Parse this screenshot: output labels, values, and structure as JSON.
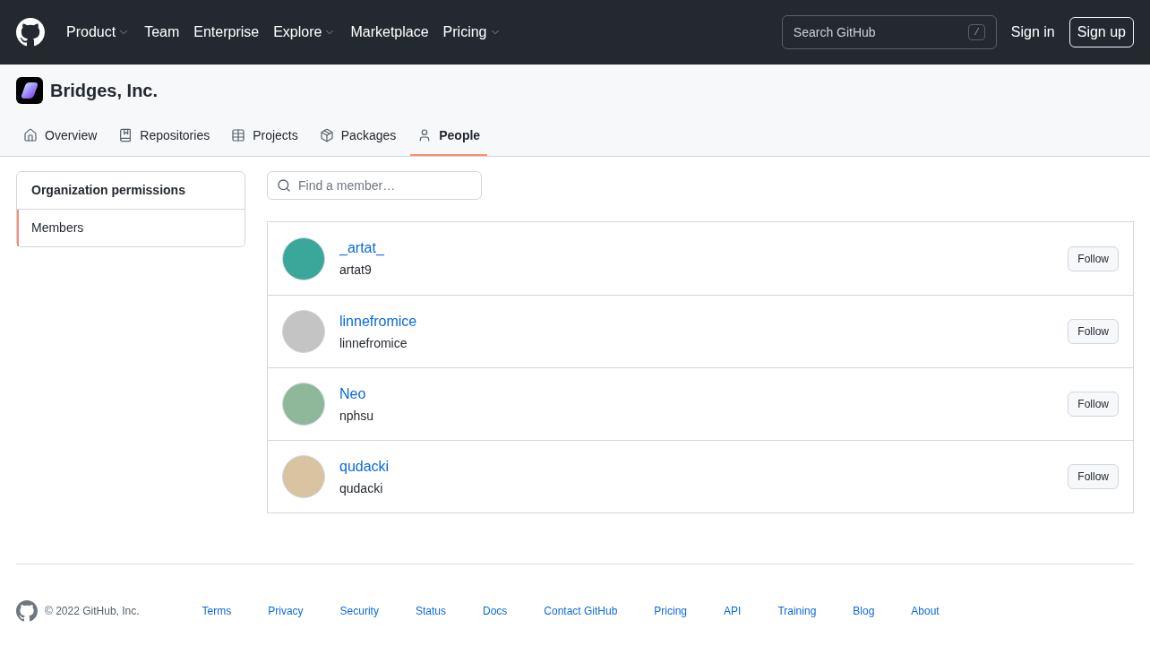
{
  "header": {
    "nav": [
      {
        "label": "Product",
        "has_menu": true
      },
      {
        "label": "Team",
        "has_menu": false
      },
      {
        "label": "Enterprise",
        "has_menu": false
      },
      {
        "label": "Explore",
        "has_menu": true
      },
      {
        "label": "Marketplace",
        "has_menu": false
      },
      {
        "label": "Pricing",
        "has_menu": true
      }
    ],
    "search": {
      "placeholder": "Search GitHub",
      "shortcut": "/"
    },
    "sign_in": "Sign in",
    "sign_up": "Sign up"
  },
  "org": {
    "name": "Bridges, Inc.",
    "tabs": [
      {
        "label": "Overview",
        "selected": false
      },
      {
        "label": "Repositories",
        "selected": false
      },
      {
        "label": "Projects",
        "selected": false
      },
      {
        "label": "Packages",
        "selected": false
      },
      {
        "label": "People",
        "selected": true
      }
    ]
  },
  "sidebar": {
    "title": "Organization permissions",
    "items": [
      {
        "label": "Members",
        "selected": true
      }
    ]
  },
  "member_search": {
    "placeholder": "Find a member…"
  },
  "members": [
    {
      "name": "_artat_",
      "login": "artat9",
      "button": "Follow"
    },
    {
      "name": "linnefromice",
      "login": "linnefromice",
      "button": "Follow"
    },
    {
      "name": "Neo",
      "login": "nphsu",
      "button": "Follow"
    },
    {
      "name": "qudacki",
      "login": "qudacki",
      "button": "Follow"
    }
  ],
  "footer": {
    "copyright": "© 2022 GitHub, Inc.",
    "links": [
      "Terms",
      "Privacy",
      "Security",
      "Status",
      "Docs",
      "Contact GitHub",
      "Pricing",
      "API",
      "Training",
      "Blog",
      "About"
    ]
  }
}
